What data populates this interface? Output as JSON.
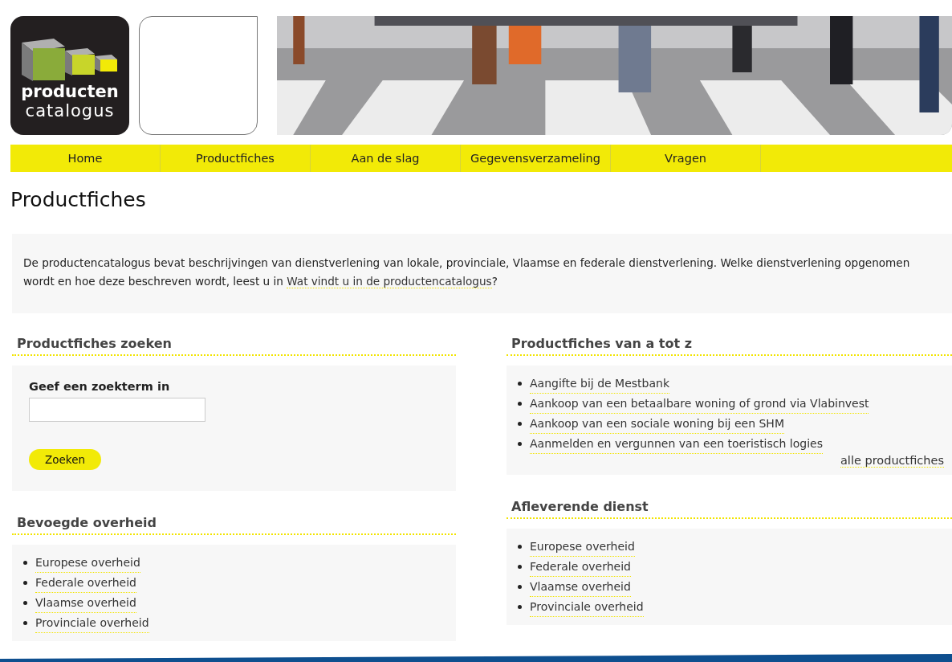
{
  "logo": {
    "line1": "producten",
    "line2": "catalogus"
  },
  "nav": [
    "Home",
    "Productfiches",
    "Aan de slag",
    "Gegevensverzameling",
    "Vragen"
  ],
  "page_title": "Productfiches",
  "intro": {
    "text": "De productencatalogus bevat beschrijvingen van dienstverlening van lokale, provinciale, Vlaamse en federale dienstverlening. Welke dienstverlening opgenomen wordt en hoe deze beschreven wordt, leest u in ",
    "link": "Wat vindt u in de productencatalogus",
    "after": "?"
  },
  "search_section": {
    "heading": "Productfiches zoeken",
    "label": "Geef een zoekterm in",
    "button": "Zoeken"
  },
  "az_section": {
    "heading": "Productfiches van a tot z",
    "items": [
      "Aangifte bij de Mestbank",
      "Aankoop van een betaalbare woning of grond via Vlabinvest",
      "Aankoop van een sociale woning bij een SHM",
      "Aanmelden en vergunnen van een toeristisch logies"
    ],
    "more_link": "alle productfiches"
  },
  "authority_section": {
    "heading": "Bevoegde overheid",
    "items": [
      "Europese overheid",
      "Federale overheid",
      "Vlaamse overheid",
      "Provinciale overheid"
    ]
  },
  "delivering_section": {
    "heading": "Afleverende dienst",
    "items": [
      "Europese overheid",
      "Federale overheid",
      "Vlaamse overheid",
      "Provinciale overheid"
    ]
  }
}
